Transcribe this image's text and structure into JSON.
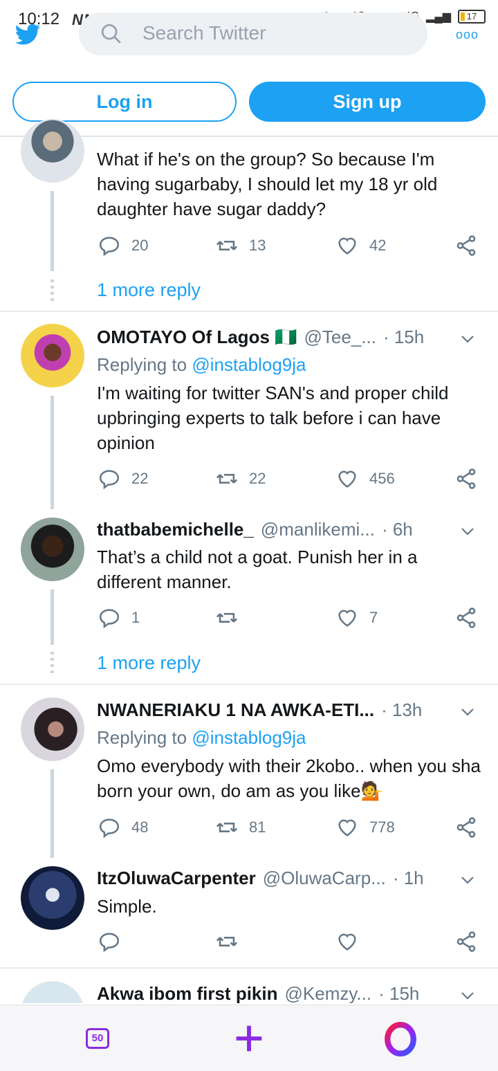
{
  "status_bar": {
    "time": "10:12",
    "left_icons": "NNVNN",
    "network_1": "4G",
    "network_2": "4G",
    "battery": "17"
  },
  "search": {
    "placeholder": "Search Twitter"
  },
  "auth": {
    "login": "Log in",
    "signup": "Sign up"
  },
  "tweets": [
    {
      "body": "What if he's on the group? So because I'm having sugarbaby, I should let my 18 yr old daughter have sugar daddy?",
      "replies": "20",
      "retweets": "13",
      "likes": "42",
      "more_reply": "1 more reply"
    },
    {
      "name": "OMOTAYO Of Lagos 🇳🇬",
      "handle": "@Tee_...",
      "time": "· 15h",
      "replying_prefix": "Replying to",
      "replying_to": "@instablog9ja",
      "body": "I'm waiting for twitter SAN's and proper child  upbringing experts to talk before i can have opinion",
      "replies": "22",
      "retweets": "22",
      "likes": "456"
    },
    {
      "name": "thatbabemichelle_",
      "handle": "@manlikemi...",
      "time": "· 6h",
      "body": "That’s a child not a goat. Punish her in a different manner.",
      "replies": "1",
      "retweets": "",
      "likes": "7",
      "more_reply": "1 more reply"
    },
    {
      "name": "NWANERIAKU 1 NA AWKA-ETI...",
      "time": "· 13h",
      "replying_prefix": "Replying to",
      "replying_to": "@instablog9ja",
      "body": "Omo everybody with their 2kobo.. when you sha born your own, do am as you like💁",
      "replies": "48",
      "retweets": "81",
      "likes": "778"
    },
    {
      "name": "ItzOluwaCarpenter",
      "handle": "@OluwaCarp...",
      "time": "· 1h",
      "body": "Simple.",
      "replies": "",
      "retweets": "",
      "likes": ""
    },
    {
      "name": "Akwa ibom first pikin",
      "handle": "@Kemzy...",
      "time": "· 15h"
    }
  ],
  "bottom_bar": {
    "tab_count": "50"
  },
  "colors": {
    "accent": "#1da1f2",
    "opera": "#8a2be2",
    "text_secondary": "#657786"
  }
}
